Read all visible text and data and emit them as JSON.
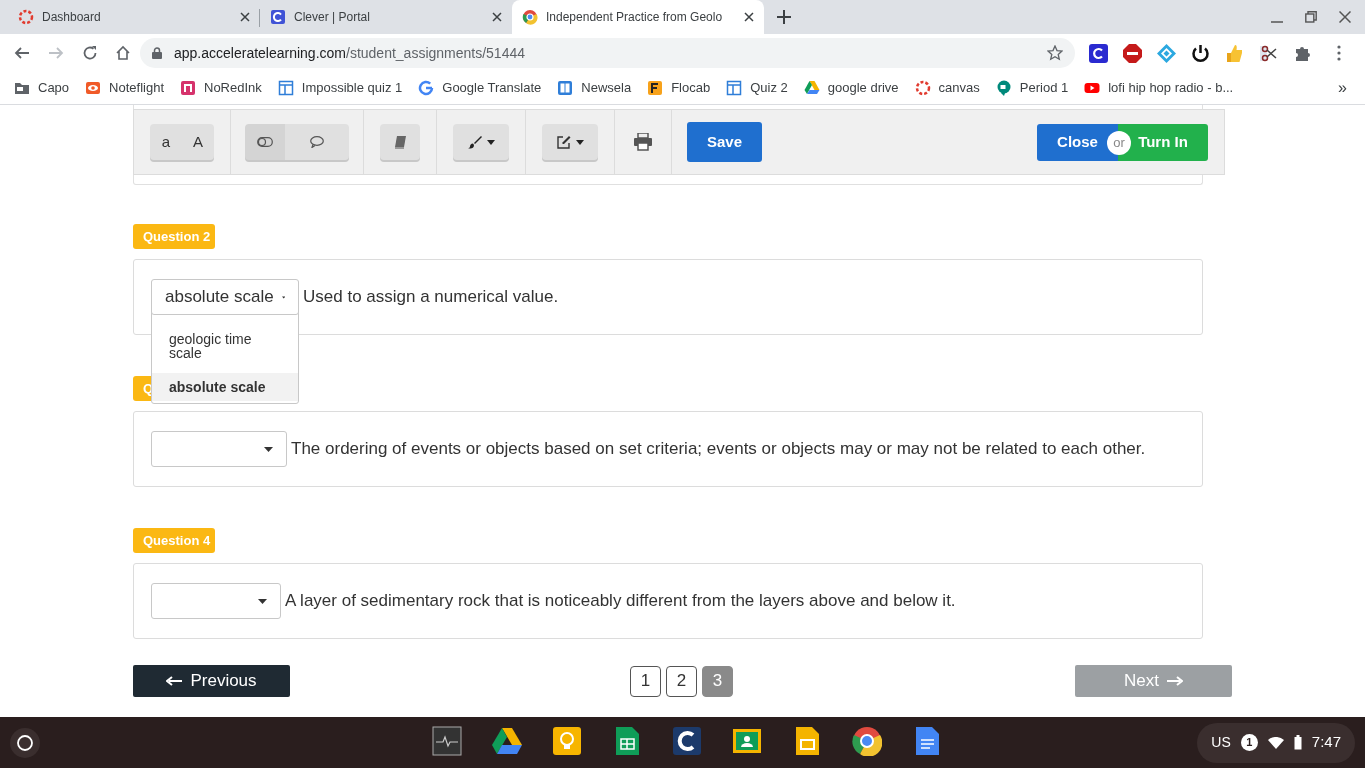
{
  "browser_tabs": [
    {
      "title": "Dashboard",
      "selected": false
    },
    {
      "title": "Clever | Portal",
      "selected": false
    },
    {
      "title": "Independent Practice from Geolo",
      "selected": true
    }
  ],
  "address": {
    "host": "app.acceleratelearning.com",
    "path": "/student_assignments/51444"
  },
  "bookmarks": [
    {
      "label": "Capo"
    },
    {
      "label": "Noteflight"
    },
    {
      "label": "NoRedInk"
    },
    {
      "label": "Impossible quiz 1"
    },
    {
      "label": "Google Translate"
    },
    {
      "label": "Newsela"
    },
    {
      "label": "Flocab"
    },
    {
      "label": "Quiz 2"
    },
    {
      "label": "google drive"
    },
    {
      "label": "canvas"
    },
    {
      "label": "Period 1"
    },
    {
      "label": "lofi hip hop radio - b..."
    }
  ],
  "bookmarks_more": "»",
  "toolbar": {
    "font_buttons": [
      "a",
      "A"
    ],
    "save": "Save",
    "close": "Close",
    "or": "or",
    "turn_in": "Turn In"
  },
  "questions": [
    {
      "badge": "Question 2",
      "answer": "absolute scale",
      "text": "Used to assign a numerical value.",
      "open": true,
      "options": [
        {
          "label": "geologic time scale",
          "selected": false
        },
        {
          "label": "absolute scale",
          "selected": true
        }
      ]
    },
    {
      "badge": "Q",
      "text": "The ordering of events or objects based on set criteria; events or objects may or may not be related to each other.",
      "open": false
    },
    {
      "badge": "Question 4",
      "text": "A layer of sedimentary rock that is noticeably different from the layers above and below it.",
      "open": false
    }
  ],
  "pagination": {
    "previous": "Previous",
    "next": "Next",
    "pages": [
      {
        "label": "1",
        "selected": false
      },
      {
        "label": "2",
        "selected": false
      },
      {
        "label": "3",
        "selected": true
      }
    ]
  },
  "shelf": {
    "keyboard": "US",
    "notifications": "1",
    "time": "7:47"
  }
}
